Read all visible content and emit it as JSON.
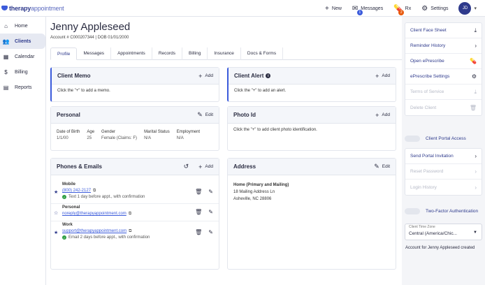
{
  "brand": {
    "name_bold": "therapy",
    "name_light": "appointment"
  },
  "topbar": {
    "new_label": "New",
    "messages_label": "Messages",
    "messages_badge": "1",
    "rx_label": "Rx",
    "rx_badge": "2",
    "settings_label": "Settings",
    "avatar_initials": "JD"
  },
  "sidebar": {
    "items": [
      {
        "label": "Home",
        "icon": "home-icon"
      },
      {
        "label": "Clients",
        "icon": "users-icon"
      },
      {
        "label": "Calendar",
        "icon": "calendar-icon"
      },
      {
        "label": "Billing",
        "icon": "dollar-icon"
      },
      {
        "label": "Reports",
        "icon": "report-icon"
      }
    ]
  },
  "client": {
    "name": "Jenny Appleseed",
    "meta": "Account # C000207344  |  DOB 01/01/2000"
  },
  "tabs": [
    "Profile",
    "Messages",
    "Appointments",
    "Records",
    "Billing",
    "Insurance",
    "Docs & Forms"
  ],
  "cards": {
    "memo": {
      "title": "Client Memo",
      "action": "Add",
      "body": "Click the \"+\" to add a memo."
    },
    "alert": {
      "title": "Client Alert",
      "action": "Add",
      "body": "Click the \"+\" to add an alert."
    },
    "personal": {
      "title": "Personal",
      "action": "Edit",
      "fields": [
        {
          "label": "Date of Birth",
          "value": "1/1/00"
        },
        {
          "label": "Age",
          "value": "25"
        },
        {
          "label": "Gender",
          "value": "Female (Claims: F)"
        },
        {
          "label": "Marital Status",
          "value": "N/A"
        },
        {
          "label": "Employment",
          "value": "N/A"
        }
      ]
    },
    "photo": {
      "title": "Photo Id",
      "action": "Add",
      "body": "Click the \"+\" to add client photo identification."
    },
    "phones": {
      "title": "Phones & Emails",
      "action": "Add",
      "rows": [
        {
          "type": "Mobile",
          "value": "(800) 242-2127",
          "note": "Text 1 day before appt., with confirmation"
        },
        {
          "type": "Personal",
          "value": "noreply@therapyappointment.com",
          "note": ""
        },
        {
          "type": "Work",
          "value": "support@therapyappointment.com",
          "note": "Email 2 days before appt., with confirmation"
        }
      ]
    },
    "address": {
      "title": "Address",
      "action": "Edit",
      "heading": "Home (Primary and Mailing)",
      "line1": "18 Mailing Address Ln",
      "line2": "Asheville, NC 28806"
    }
  },
  "right_panel": {
    "group1": [
      "Client Face Sheet",
      "Reminder History",
      "Open ePrescribe",
      "ePrescribe Settings",
      "Terms of Service",
      "Delete Client"
    ],
    "portal_access": "Client Portal Access",
    "group2": [
      "Send Portal Invitation",
      "Reset Password",
      "Login History"
    ],
    "two_factor": "Two-Factor Authentication",
    "timezone_label": "Client Time Zone",
    "timezone_value": "Central (America/Chic...",
    "created": "Account for Jenny Appleseed created"
  }
}
